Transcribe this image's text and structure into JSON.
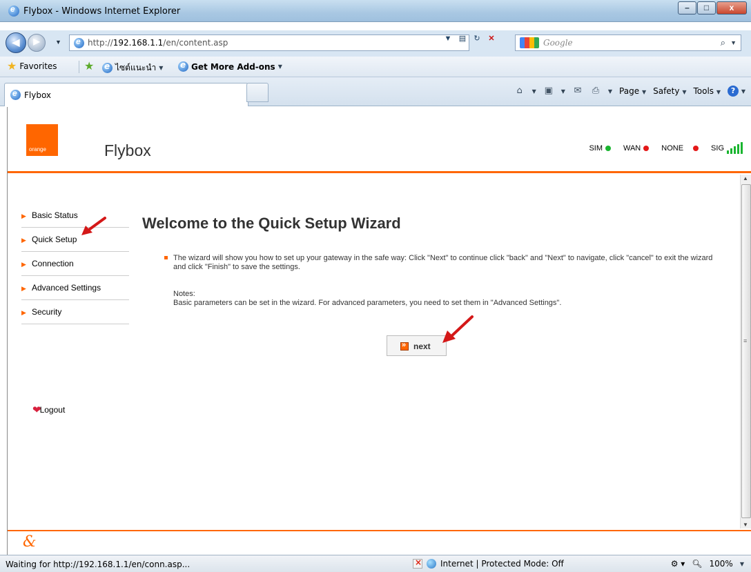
{
  "window": {
    "title": "Flybox - Windows Internet Explorer",
    "min_glyph": "–",
    "max_glyph": "□",
    "close_glyph": "x"
  },
  "addressbar": {
    "url_prefix": "http://",
    "url_host": "192.168.1.1",
    "url_path": "/en/content.asp",
    "search_placeholder": "Google"
  },
  "favorites": {
    "favorites_label": "Favorites",
    "item1_label": "ไซต์แนะนำ",
    "item2_label": "Get More Add-ons"
  },
  "tabs": {
    "active_tab": "Flybox"
  },
  "commandbar": {
    "page": "Page",
    "safety": "Safety",
    "tools": "Tools"
  },
  "header": {
    "logo_text": "orange",
    "brand": "Flybox",
    "indicators": {
      "sim": "SIM",
      "wan": "WAN",
      "none": "NONE",
      "sig": "SIG"
    },
    "colors": {
      "accent": "#ff6600",
      "ok": "#19b52f",
      "error": "#e41818"
    }
  },
  "sidebar": {
    "items": [
      {
        "label": "Basic Status"
      },
      {
        "label": "Quick Setup"
      },
      {
        "label": "Connection"
      },
      {
        "label": "Advanced Settings"
      },
      {
        "label": "Security"
      }
    ],
    "logout": "Logout"
  },
  "main": {
    "title": "Welcome to the Quick Setup Wizard",
    "intro": "The wizard will show you how to set up your gateway in the safe way: Click \"Next\" to continue click \"back\" and \"Next\" to navigate, click \"cancel\" to exit the wizard and click \"Finish\" to save the settings.",
    "notes_heading": "Notes:",
    "notes_body": "Basic parameters can be set in the wizard. For advanced parameters, you need to set them in \"Advanced Settings\".",
    "next_label": "next"
  },
  "statusbar": {
    "status": "Waiting for http://192.168.1.1/en/conn.asp...",
    "zone": "Internet | Protected Mode: Off",
    "zoom": "100%"
  }
}
